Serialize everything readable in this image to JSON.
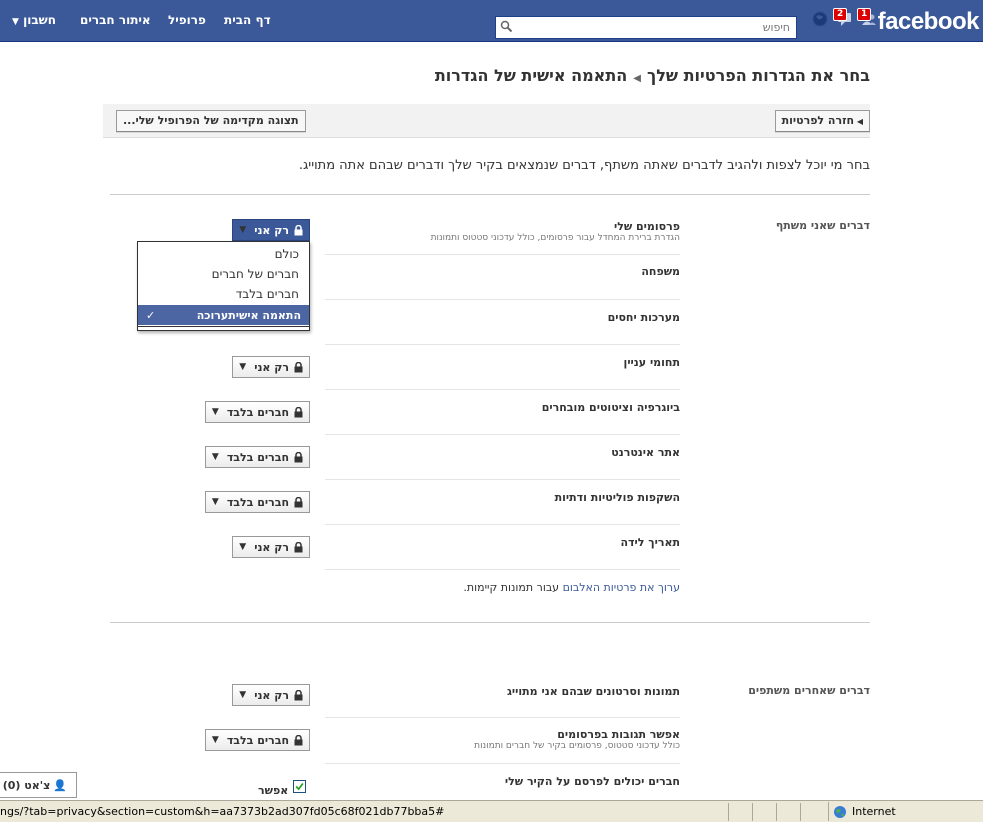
{
  "topbar": {
    "brand": "facebook",
    "search_placeholder": "חיפוש",
    "notifications": [
      {
        "icon": "friend-requests-icon",
        "count": "1"
      },
      {
        "icon": "messages-icon",
        "count": "2"
      },
      {
        "icon": "globe-notifications-icon",
        "count": ""
      }
    ],
    "nav": [
      {
        "label": "דף הבית"
      },
      {
        "label": "פרופיל"
      },
      {
        "label": "איתור חברים"
      },
      {
        "label": "חשבון"
      }
    ]
  },
  "heading": {
    "crumb": "בחר את הגדרות הפרטיות שלך",
    "current": "התאמה אישית של הגדרות"
  },
  "toolbar": {
    "back_label": "חזרה לפרטיות",
    "preview_label": "תצוגה מקדימה של הפרופיל שלי..."
  },
  "description": "בחר מי יוכל לצפות ולהגיב לדברים שאתה משתף, דברים שנמצאים בקיר שלך ודברים שבהם אתה מתוייג.",
  "section_share": {
    "label": "דברים שאני משתף",
    "rows": [
      {
        "label": "פרסומים שלי",
        "sub": "הגדרת ברירת המחדל עבור פרסומים, כולל עדכוני סטטוס ותמונות",
        "value": "רק אני"
      },
      {
        "label": "משפחה",
        "sub": "",
        "value": ""
      },
      {
        "label": "מערכות יחסים",
        "sub": "",
        "value": ""
      },
      {
        "label": "תחומי עניין",
        "sub": "",
        "value": "רק אני"
      },
      {
        "label": "ביוגרפיה וציטוטים מובחרים",
        "sub": "",
        "value": "חברים בלבד"
      },
      {
        "label": "אתר אינטרנט",
        "sub": "",
        "value": "חברים בלבד"
      },
      {
        "label": "השקפות פוליטיות ודתיות",
        "sub": "",
        "value": "חברים בלבד"
      },
      {
        "label": "תאריך לידה",
        "sub": "",
        "value": "רק אני"
      }
    ],
    "album_link": "ערוך את פרטיות האלבום",
    "album_text": " עבור תמונות קיימות."
  },
  "dropdown": {
    "options": [
      "כולם",
      "חברים של חברים",
      "חברים בלבד"
    ],
    "selected": "התאמה אישיתערוכה"
  },
  "section_others": {
    "label": "דברים שאחרים משתפים",
    "rows": [
      {
        "label": "תמונות וסרטונים שבהם אני מתוייג",
        "sub": "",
        "value": "רק אני"
      },
      {
        "label": "אפשר תגובות בפרסומים",
        "sub": "כולל עדכוני סטטוס, פרסומים בקיר של חברים ותמונות",
        "value": "חברים בלבד"
      },
      {
        "label": "חברים יכולים לפרסם על הקיר שלי",
        "sub": "",
        "value": ""
      }
    ],
    "allow_label": "אפשר",
    "allow_checked": true
  },
  "chat": {
    "label": "צ'אט (0)"
  },
  "statusbar": {
    "url": "ngs/?tab=privacy&section=custom&h=aa7373b2ad307fd05c68f021db77bba5#",
    "zone": "Internet"
  },
  "colors": {
    "brand_blue": "#3b5998",
    "selected_blue": "#4c66a4",
    "badge_red": "#dd0000"
  }
}
